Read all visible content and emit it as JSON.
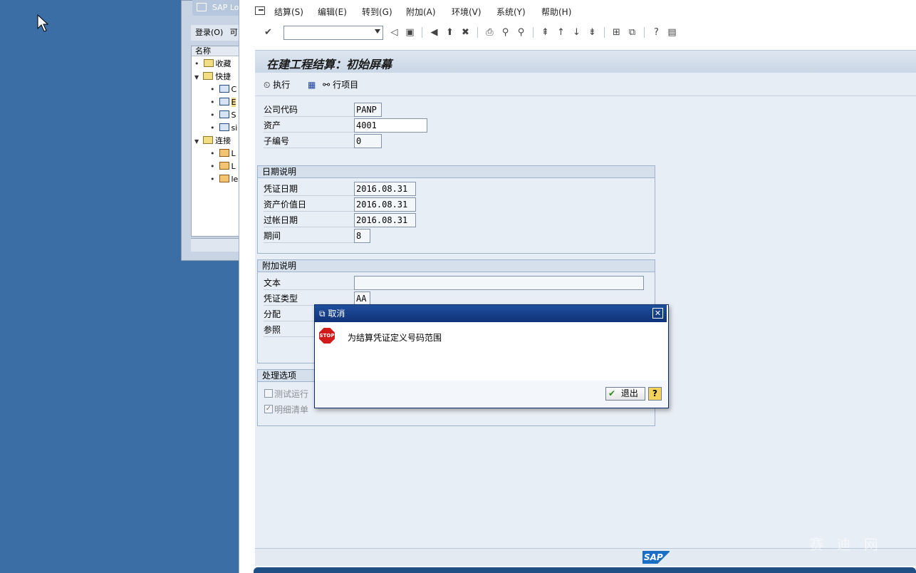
{
  "background_window": {
    "title": "SAP Lo",
    "menu": [
      "登录(O)",
      "可"
    ],
    "tree_header": "名称",
    "tree": [
      {
        "label": "收藏",
        "type": "folder",
        "level": 0
      },
      {
        "label": "快捷",
        "type": "folder",
        "level": 0,
        "expanded": true
      },
      {
        "label": "C",
        "type": "shortcut",
        "level": 1
      },
      {
        "label": "E",
        "type": "shortcut",
        "level": 1,
        "selected": true
      },
      {
        "label": "S",
        "type": "shortcut",
        "level": 1
      },
      {
        "label": "si",
        "type": "shortcut",
        "level": 1
      },
      {
        "label": "连接",
        "type": "folder",
        "level": 0,
        "expanded": true
      },
      {
        "label": "L",
        "type": "connection",
        "level": 1
      },
      {
        "label": "L",
        "type": "connection",
        "level": 1
      },
      {
        "label": "le",
        "type": "connection",
        "level": 1
      }
    ]
  },
  "menubar": {
    "items": [
      "结算(S)",
      "编辑(E)",
      "转到(G)",
      "附加(A)",
      "环境(V)",
      "系统(Y)",
      "帮助(H)"
    ]
  },
  "toolbar": {
    "command_field_value": "",
    "icons": [
      "enter-check-icon",
      "save-icon",
      "back-icon",
      "exit-icon",
      "cancel-icon",
      "print-icon",
      "find-icon",
      "find-next-icon",
      "first-page-icon",
      "prev-page-icon",
      "next-page-icon",
      "last-page-icon",
      "create-session-icon",
      "shortcut-icon",
      "help-icon",
      "layout-icon"
    ]
  },
  "screen": {
    "title": "在建工程结算：初始屏幕",
    "app_buttons": {
      "execute": "执行",
      "line_items": "行项目"
    }
  },
  "form": {
    "company_code_label": "公司代码",
    "company_code_value": "PANP",
    "asset_label": "资产",
    "asset_value": "4001",
    "subnumber_label": "子编号",
    "subnumber_value": "0",
    "dates_group": {
      "title": "日期说明",
      "doc_date_label": "凭证日期",
      "doc_date_value": "2016.08.31",
      "value_date_label": "资产价值日",
      "value_date_value": "2016.08.31",
      "posting_date_label": "过帐日期",
      "posting_date_value": "2016.08.31",
      "period_label": "期间",
      "period_value": "8"
    },
    "additional_group": {
      "title": "附加说明",
      "text_label": "文本",
      "text_value": "",
      "doc_type_label": "凭证类型",
      "doc_type_value": "AA",
      "assignment_label": "分配",
      "reference_label": "参照"
    },
    "processing_group": {
      "title": "处理选项",
      "test_run_label": "测试运行",
      "test_run_checked": false,
      "detail_list_label": "明细清单",
      "detail_list_checked": true
    }
  },
  "dialog": {
    "title": "取消",
    "message": "为结算凭证定义号码范围",
    "stop_text": "STOP",
    "exit_button": "退出",
    "help_button": "?"
  },
  "statusbar": {
    "logo": "SAP"
  },
  "watermark": "赛 迪 网"
}
